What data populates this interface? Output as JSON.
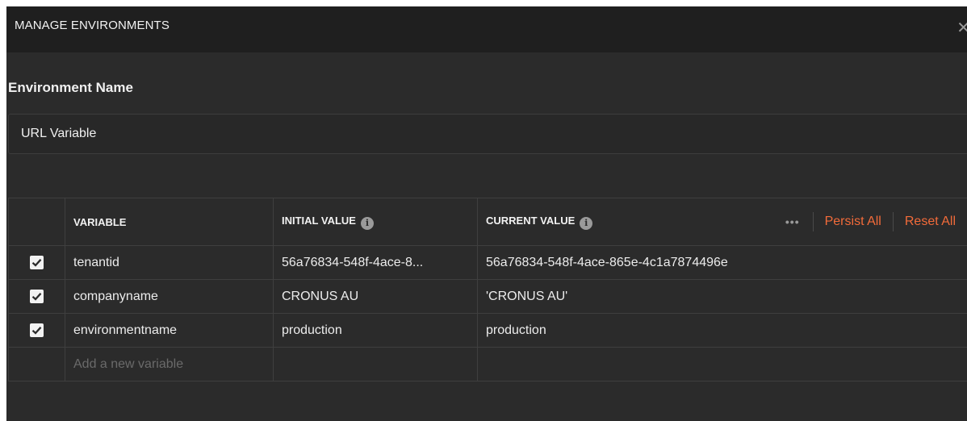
{
  "header": {
    "title": "MANAGE ENVIRONMENTS"
  },
  "environment": {
    "label": "Environment Name",
    "value": "URL Variable"
  },
  "table": {
    "columns": {
      "variable": "VARIABLE",
      "initial": "INITIAL VALUE",
      "current": "CURRENT VALUE"
    },
    "actions": {
      "more": "•••",
      "persist": "Persist All",
      "reset": "Reset All"
    },
    "rows": [
      {
        "checked": true,
        "variable": "tenantid",
        "initial": "56a76834-548f-4ace-8...",
        "current": "56a76834-548f-4ace-865e-4c1a7874496e"
      },
      {
        "checked": true,
        "variable": "companyname",
        "initial": "CRONUS AU",
        "current": "'CRONUS AU'"
      },
      {
        "checked": true,
        "variable": "environmentname",
        "initial": "production",
        "current": "production"
      }
    ],
    "new_row_placeholder": "Add a new variable"
  },
  "icons": {
    "info": "info-icon",
    "check": "check-icon",
    "close": "close-icon"
  },
  "colors": {
    "accent": "#f26b3a",
    "background": "#2b2b2b",
    "header": "#1f1f1f"
  }
}
